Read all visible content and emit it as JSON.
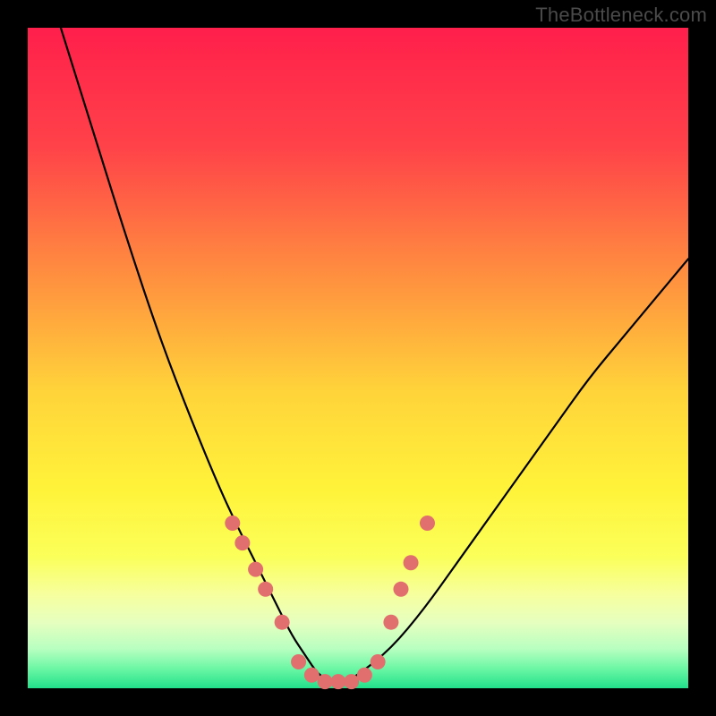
{
  "watermark": "TheBottleneck.com",
  "chart_data": {
    "type": "line",
    "title": "",
    "xlabel": "",
    "ylabel": "",
    "xlim": [
      0,
      100
    ],
    "ylim": [
      0,
      100
    ],
    "grid": false,
    "legend": false,
    "series": [
      {
        "name": "bottleneck-curve",
        "x": [
          5,
          10,
          15,
          20,
          25,
          30,
          35,
          38,
          40,
          42,
          44,
          46,
          48,
          50,
          55,
          60,
          65,
          70,
          75,
          80,
          85,
          90,
          95,
          100
        ],
        "y": [
          100,
          84,
          68,
          53,
          40,
          28,
          18,
          12,
          8,
          5,
          2,
          1,
          1,
          2,
          6,
          12,
          19,
          26,
          33,
          40,
          47,
          53,
          59,
          65
        ]
      }
    ],
    "highlight_points": {
      "name": "marker-dots",
      "x": [
        31,
        32.5,
        34.5,
        36,
        38.5,
        41,
        43,
        45,
        47,
        49,
        51,
        53,
        55,
        56.5,
        58,
        60.5
      ],
      "y": [
        25,
        22,
        18,
        15,
        10,
        4,
        2,
        1,
        1,
        1,
        2,
        4,
        10,
        15,
        19,
        25
      ]
    },
    "background": {
      "type": "vertical-gradient",
      "stops": [
        {
          "pos": 0.0,
          "color": "#ff1f4b"
        },
        {
          "pos": 0.18,
          "color": "#ff4249"
        },
        {
          "pos": 0.38,
          "color": "#ff913f"
        },
        {
          "pos": 0.55,
          "color": "#ffd33a"
        },
        {
          "pos": 0.7,
          "color": "#fff33a"
        },
        {
          "pos": 0.8,
          "color": "#fbff59"
        },
        {
          "pos": 0.86,
          "color": "#f6ffa0"
        },
        {
          "pos": 0.9,
          "color": "#e6ffbf"
        },
        {
          "pos": 0.94,
          "color": "#b8ffc0"
        },
        {
          "pos": 0.97,
          "color": "#6cf7a5"
        },
        {
          "pos": 1.0,
          "color": "#22e08a"
        }
      ]
    }
  }
}
